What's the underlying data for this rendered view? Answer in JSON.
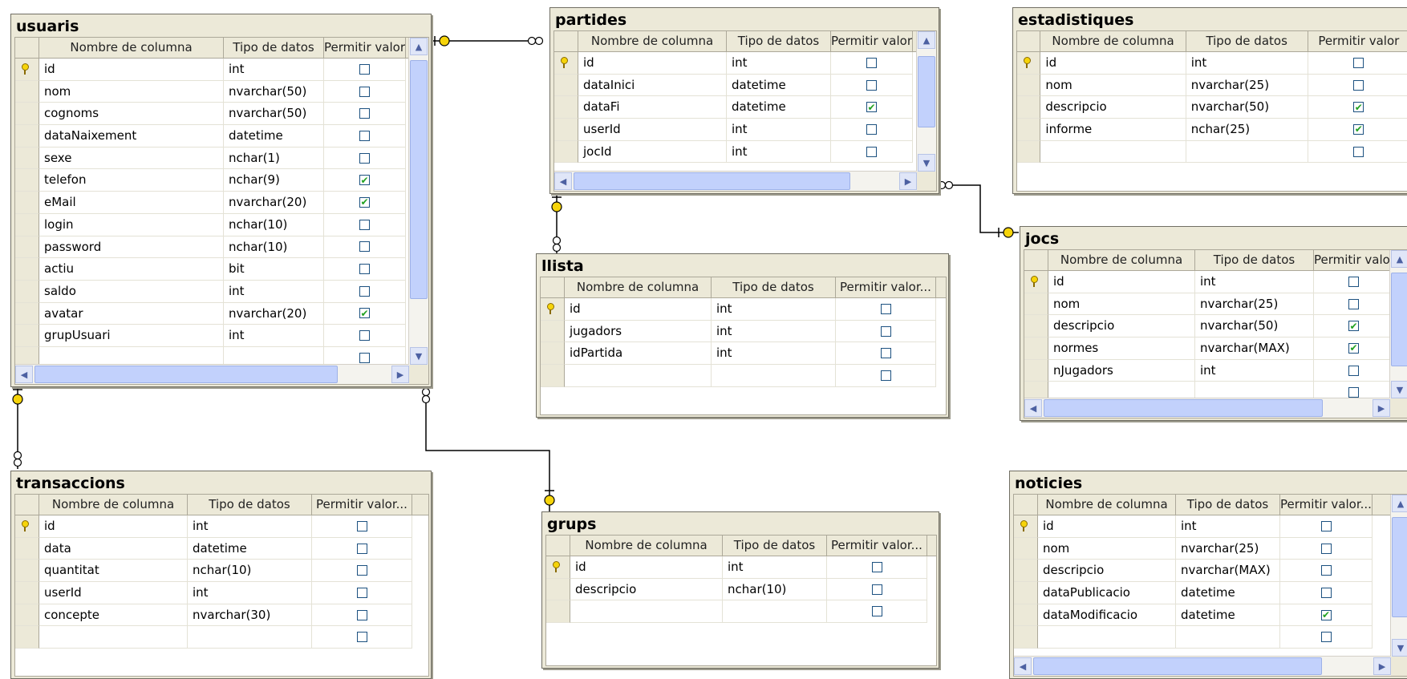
{
  "columns_header": {
    "name": "Nombre de columna",
    "type": "Tipo de datos",
    "nulls": "Permitir valor...",
    "nulls_short": "Permitir valor"
  },
  "tables": {
    "usuaris": {
      "title": "usuaris",
      "rows": [
        {
          "name": "id",
          "type": "int",
          "nullable": false,
          "pk": true
        },
        {
          "name": "nom",
          "type": "nvarchar(50)",
          "nullable": false
        },
        {
          "name": "cognoms",
          "type": "nvarchar(50)",
          "nullable": false
        },
        {
          "name": "dataNaixement",
          "type": "datetime",
          "nullable": false
        },
        {
          "name": "sexe",
          "type": "nchar(1)",
          "nullable": false
        },
        {
          "name": "telefon",
          "type": "nchar(9)",
          "nullable": true
        },
        {
          "name": "eMail",
          "type": "nvarchar(20)",
          "nullable": true
        },
        {
          "name": "login",
          "type": "nchar(10)",
          "nullable": false
        },
        {
          "name": "password",
          "type": "nchar(10)",
          "nullable": false
        },
        {
          "name": "actiu",
          "type": "bit",
          "nullable": false
        },
        {
          "name": "saldo",
          "type": "int",
          "nullable": false
        },
        {
          "name": "avatar",
          "type": "nvarchar(20)",
          "nullable": true
        },
        {
          "name": "grupUsuari",
          "type": "int",
          "nullable": false
        }
      ]
    },
    "partides": {
      "title": "partides",
      "rows": [
        {
          "name": "id",
          "type": "int",
          "nullable": false,
          "pk": true
        },
        {
          "name": "dataInici",
          "type": "datetime",
          "nullable": false
        },
        {
          "name": "dataFi",
          "type": "datetime",
          "nullable": true
        },
        {
          "name": "userId",
          "type": "int",
          "nullable": false
        },
        {
          "name": "jocId",
          "type": "int",
          "nullable": false
        }
      ]
    },
    "estadistiques": {
      "title": "estadistiques",
      "rows": [
        {
          "name": "id",
          "type": "int",
          "nullable": false,
          "pk": true
        },
        {
          "name": "nom",
          "type": "nvarchar(25)",
          "nullable": false
        },
        {
          "name": "descripcio",
          "type": "nvarchar(50)",
          "nullable": true
        },
        {
          "name": "informe",
          "type": "nchar(25)",
          "nullable": true
        }
      ]
    },
    "llista": {
      "title": "llista",
      "rows": [
        {
          "name": "id",
          "type": "int",
          "nullable": false,
          "pk": true
        },
        {
          "name": "jugadors",
          "type": "int",
          "nullable": false
        },
        {
          "name": "idPartida",
          "type": "int",
          "nullable": false
        }
      ]
    },
    "jocs": {
      "title": "jocs",
      "rows": [
        {
          "name": "id",
          "type": "int",
          "nullable": false,
          "pk": true
        },
        {
          "name": "nom",
          "type": "nvarchar(25)",
          "nullable": false
        },
        {
          "name": "descripcio",
          "type": "nvarchar(50)",
          "nullable": true
        },
        {
          "name": "normes",
          "type": "nvarchar(MAX)",
          "nullable": true
        },
        {
          "name": "nJugadors",
          "type": "int",
          "nullable": false
        }
      ]
    },
    "transaccions": {
      "title": "transaccions",
      "rows": [
        {
          "name": "id",
          "type": "int",
          "nullable": false,
          "pk": true
        },
        {
          "name": "data",
          "type": "datetime",
          "nullable": false
        },
        {
          "name": "quantitat",
          "type": "nchar(10)",
          "nullable": false
        },
        {
          "name": "userId",
          "type": "int",
          "nullable": false
        },
        {
          "name": "concepte",
          "type": "nvarchar(30)",
          "nullable": false
        }
      ]
    },
    "grups": {
      "title": "grups",
      "rows": [
        {
          "name": "id",
          "type": "int",
          "nullable": false,
          "pk": true
        },
        {
          "name": "descripcio",
          "type": "nchar(10)",
          "nullable": false
        }
      ]
    },
    "noticies": {
      "title": "noticies",
      "rows": [
        {
          "name": "id",
          "type": "int",
          "nullable": false,
          "pk": true
        },
        {
          "name": "nom",
          "type": "nvarchar(25)",
          "nullable": false
        },
        {
          "name": "descripcio",
          "type": "nvarchar(MAX)",
          "nullable": false
        },
        {
          "name": "dataPublicacio",
          "type": "datetime",
          "nullable": false
        },
        {
          "name": "dataModificacio",
          "type": "datetime",
          "nullable": true
        }
      ]
    }
  }
}
